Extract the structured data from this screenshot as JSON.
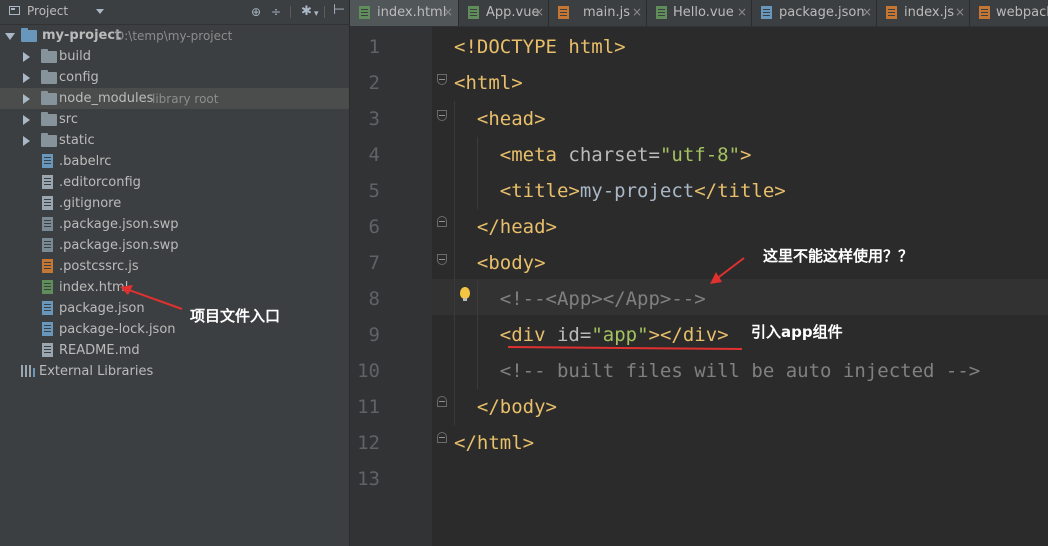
{
  "project_panel": {
    "title": "Project",
    "tree": [
      {
        "label": "my-project",
        "path": "D:\\temp\\my-project",
        "kind": "folder-root",
        "expanded": true
      },
      {
        "label": "build",
        "kind": "folder"
      },
      {
        "label": "config",
        "kind": "folder"
      },
      {
        "label": "node_modules",
        "sub": "library root",
        "kind": "folder"
      },
      {
        "label": "src",
        "kind": "folder"
      },
      {
        "label": "static",
        "kind": "folder"
      },
      {
        "label": ".babelrc",
        "kind": "file-json"
      },
      {
        "label": ".editorconfig",
        "kind": "file-text"
      },
      {
        "label": ".gitignore",
        "kind": "file-text"
      },
      {
        "label": ".package.json.swp",
        "kind": "file-swp"
      },
      {
        "label": ".package.json.swp",
        "kind": "file-swp"
      },
      {
        "label": ".postcssrc.js",
        "kind": "file-js"
      },
      {
        "label": "index.html",
        "kind": "file-html"
      },
      {
        "label": "package.json",
        "kind": "file-json"
      },
      {
        "label": "package-lock.json",
        "kind": "file-json"
      },
      {
        "label": "README.md",
        "kind": "file-md"
      },
      {
        "label": "External Libraries",
        "kind": "libraries"
      }
    ]
  },
  "tabs": [
    {
      "label": "index.html",
      "icon": "html",
      "active": true,
      "closable": true
    },
    {
      "label": "App.vue",
      "icon": "vue",
      "closable": true
    },
    {
      "label": "main.js",
      "icon": "js",
      "closable": true
    },
    {
      "label": "Hello.vue",
      "icon": "vue",
      "closable": true
    },
    {
      "label": "package.json",
      "icon": "json",
      "closable": true
    },
    {
      "label": "index.js",
      "icon": "js",
      "closable": true
    },
    {
      "label": "webpack",
      "icon": "js",
      "closable": false
    }
  ],
  "close_glyph": "×",
  "editor": {
    "line_numbers": [
      "1",
      "2",
      "3",
      "4",
      "5",
      "6",
      "7",
      "8",
      "9",
      "10",
      "11",
      "12",
      "13"
    ],
    "lines": [
      [
        "<!DOCTYPE html>"
      ],
      [
        "<html>"
      ],
      [
        "  ",
        "<head>"
      ],
      [
        "    ",
        "<meta ",
        "charset",
        "=",
        "\"utf-8\"",
        ">"
      ],
      [
        "    ",
        "<title>",
        "my-project",
        "</title>"
      ],
      [
        "  ",
        "</head>"
      ],
      [
        "  ",
        "<body>"
      ],
      [
        "    ",
        "<!--<App></App>-->"
      ],
      [
        "    ",
        "<div ",
        "id",
        "=",
        "\"app\"",
        "></div>"
      ],
      [
        "    ",
        "<!-- built files will be auto injected -->"
      ],
      [
        "  ",
        "</body>"
      ],
      [
        "</html>"
      ],
      [
        ""
      ]
    ]
  },
  "annotations": {
    "entry_note": "项目文件入口",
    "question_note": "这里不能这样使用？？",
    "import_note": "引入app组件"
  },
  "colors": {
    "annotation_red": "#e03030",
    "tag": "#e8bf6a",
    "string": "#a5c261",
    "comment": "#808080"
  }
}
